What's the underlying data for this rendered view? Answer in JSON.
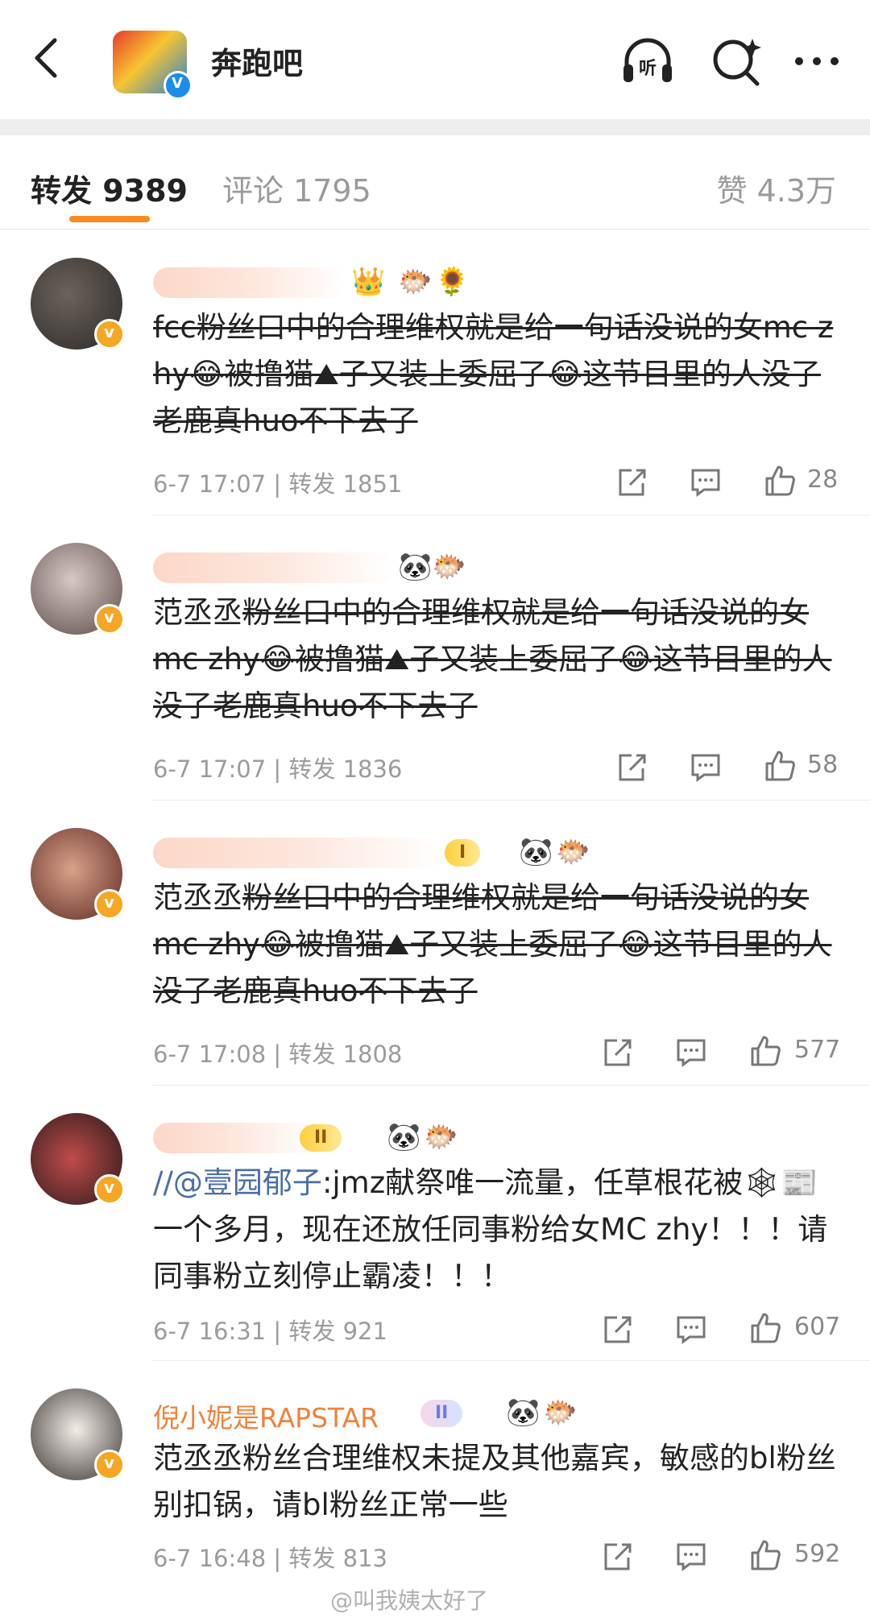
{
  "header": {
    "back_icon": "chevron-left-icon",
    "title": "奔跑吧",
    "icons": [
      "headphones-listen-icon",
      "search-sparkle-icon",
      "more-dots-icon"
    ],
    "listen_label": "听"
  },
  "tabs": {
    "repost": "转发 9389",
    "comments": "评论 1795",
    "likes": "赞 4.3万",
    "accent": "#f78d1e"
  },
  "items": [
    {
      "name": "",
      "text_parts": [
        "fcc粉丝口中的合理维权就是给一句话没说的女mc zhy",
        "被撸猫",
        "子又装上委屈了",
        "这节目里的人没了老鹿真huo不下去了"
      ],
      "meta": "6-7 17:07 | 转发 1851",
      "likes": "28"
    },
    {
      "name": "",
      "prefix": "范丞丞",
      "text_parts": [
        "粉丝口中的合理维权就是给一句话没说的女mc zhy",
        "被撸猫",
        "子又装上委屈了",
        "这节目里的人没了老鹿真huo不下去了"
      ],
      "meta": "6-7 17:07 | 转发 1836",
      "likes": "58"
    },
    {
      "name": "",
      "badge": "I",
      "prefix": "范丞丞",
      "text_parts": [
        "粉丝口中的合理维权就是给一句话没说的女mc zhy",
        "被撸猫",
        "子又装上委屈了",
        "这节目里的人没了老鹿真huo不下去了"
      ],
      "meta": "6-7 17:08 | 转发 1808",
      "likes": "577"
    },
    {
      "name": "",
      "badge": "II",
      "mention": "//@壹园郁子",
      "text_a": ":jmz献祭唯一流量，任草根花被",
      "text_b": "一个多月，现在还放任同事粉给女MC zhy！！！请同事粉立刻停止霸凌！！！",
      "meta": "6-7 16:31 | 转发 921",
      "likes": "607"
    },
    {
      "name": "倪小妮是RAPSTAR",
      "badge": "II",
      "text": "范丞丞粉丝合理维权未提及其他嘉宾，敏感的bl粉丝别扣锅，请bl粉丝正常一些",
      "meta": "6-7 16:48 | 转发 813",
      "likes": "592"
    }
  ],
  "watermark": "@叫我姨太好了"
}
